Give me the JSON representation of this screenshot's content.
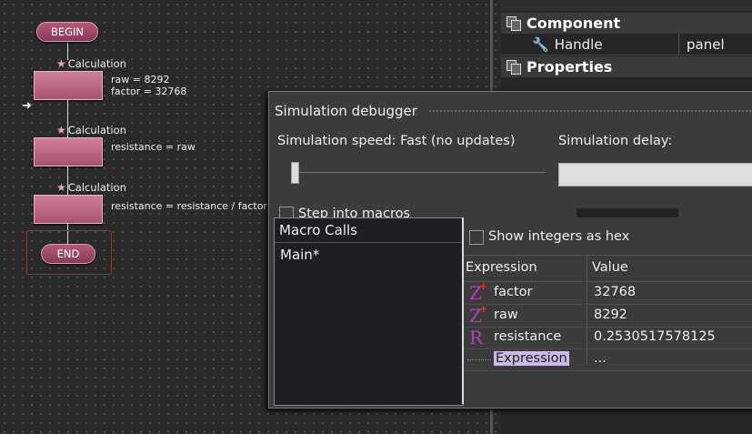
{
  "flowchart": {
    "begin_label": "BEGIN",
    "end_label": "END",
    "calculations": [
      {
        "label": "Calculation",
        "lines": [
          "raw = 8292",
          "factor = 32768"
        ]
      },
      {
        "label": "Calculation",
        "lines": [
          "resistance = raw"
        ]
      },
      {
        "label": "Calculation",
        "lines": [
          "resistance = resistance / factor"
        ]
      }
    ]
  },
  "properties_panel": {
    "component_header": "Component",
    "handle_label": "Handle",
    "handle_value": "panel",
    "properties_header": "Properties"
  },
  "debugger": {
    "title": "Simulation debugger",
    "speed_label": "Simulation speed: Fast (no updates)",
    "delay_label": "Simulation delay:",
    "speed_level": 0.0,
    "step_into_macros_label": "Step into macros",
    "show_hex_label": "Show integers as hex",
    "macro_calls_header": "Macro Calls",
    "macro_calls": [
      "Main*"
    ],
    "columns": {
      "expression": "Expression",
      "value": "Value"
    },
    "variables": [
      {
        "icon": "Z",
        "name": "factor",
        "value": "32768"
      },
      {
        "icon": "Z",
        "name": "raw",
        "value": "8292"
      },
      {
        "icon": "R",
        "name": "resistance",
        "value": "0.2530517578125"
      }
    ],
    "new_expression": {
      "name": "Expression",
      "value": "..."
    }
  }
}
